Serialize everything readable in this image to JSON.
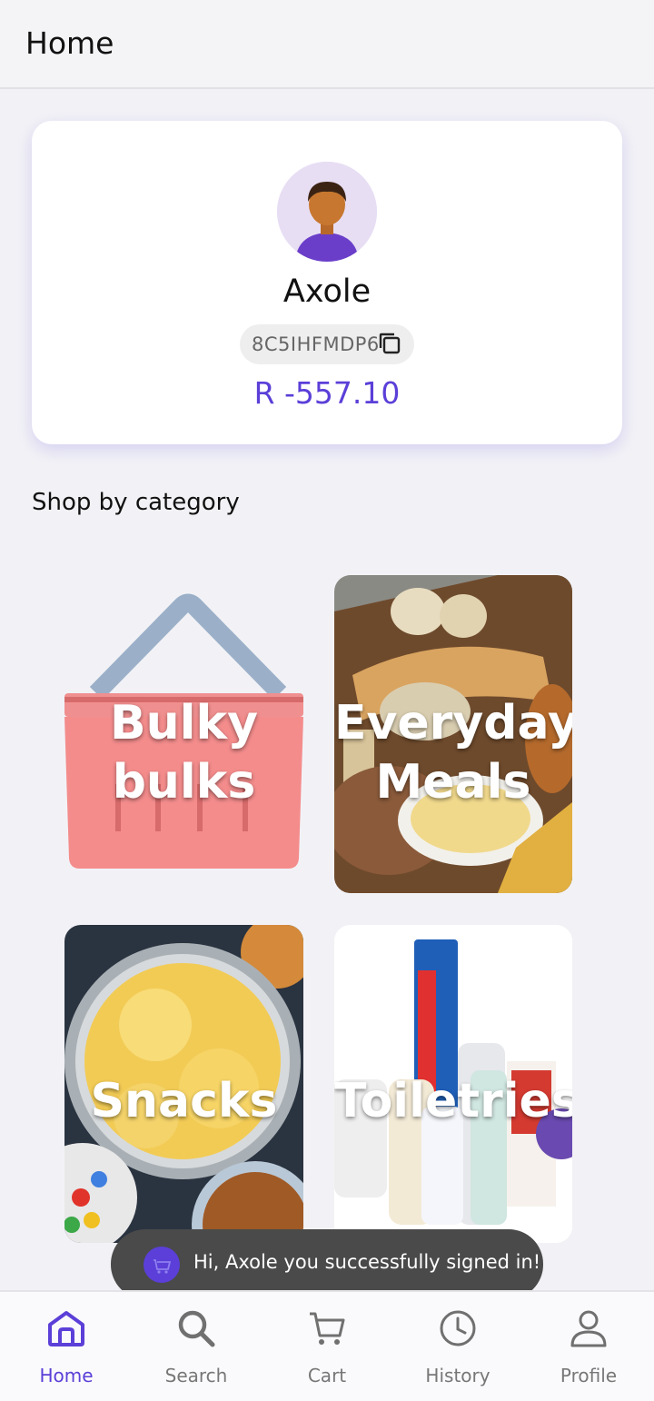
{
  "app_bar": {
    "title": "Home"
  },
  "profile": {
    "name": "Axole",
    "code": "8C5IHFMDP6",
    "balance": "R -557.10",
    "avatar_icon": "person-avatar-icon"
  },
  "section": {
    "title": "Shop by category"
  },
  "categories": [
    {
      "label_line1": "Bulky",
      "label_line2": "bulks"
    },
    {
      "label_line1": "Everyday",
      "label_line2": "Meals"
    },
    {
      "label_line1": "Snacks"
    },
    {
      "label_line1": "Toiletries"
    }
  ],
  "toast": {
    "message": "Hi, Axole you successfully signed in!"
  },
  "nav": {
    "items": [
      {
        "label": "Home",
        "icon": "home-icon",
        "active": true
      },
      {
        "label": "Search",
        "icon": "search-icon"
      },
      {
        "label": "Cart",
        "icon": "cart-icon"
      },
      {
        "label": "History",
        "icon": "history-icon"
      },
      {
        "label": "Profile",
        "icon": "profile-icon"
      }
    ]
  },
  "colors": {
    "accent": "#5b3fd8",
    "background": "#f2f2f6",
    "toast": "#4a4a4a"
  }
}
